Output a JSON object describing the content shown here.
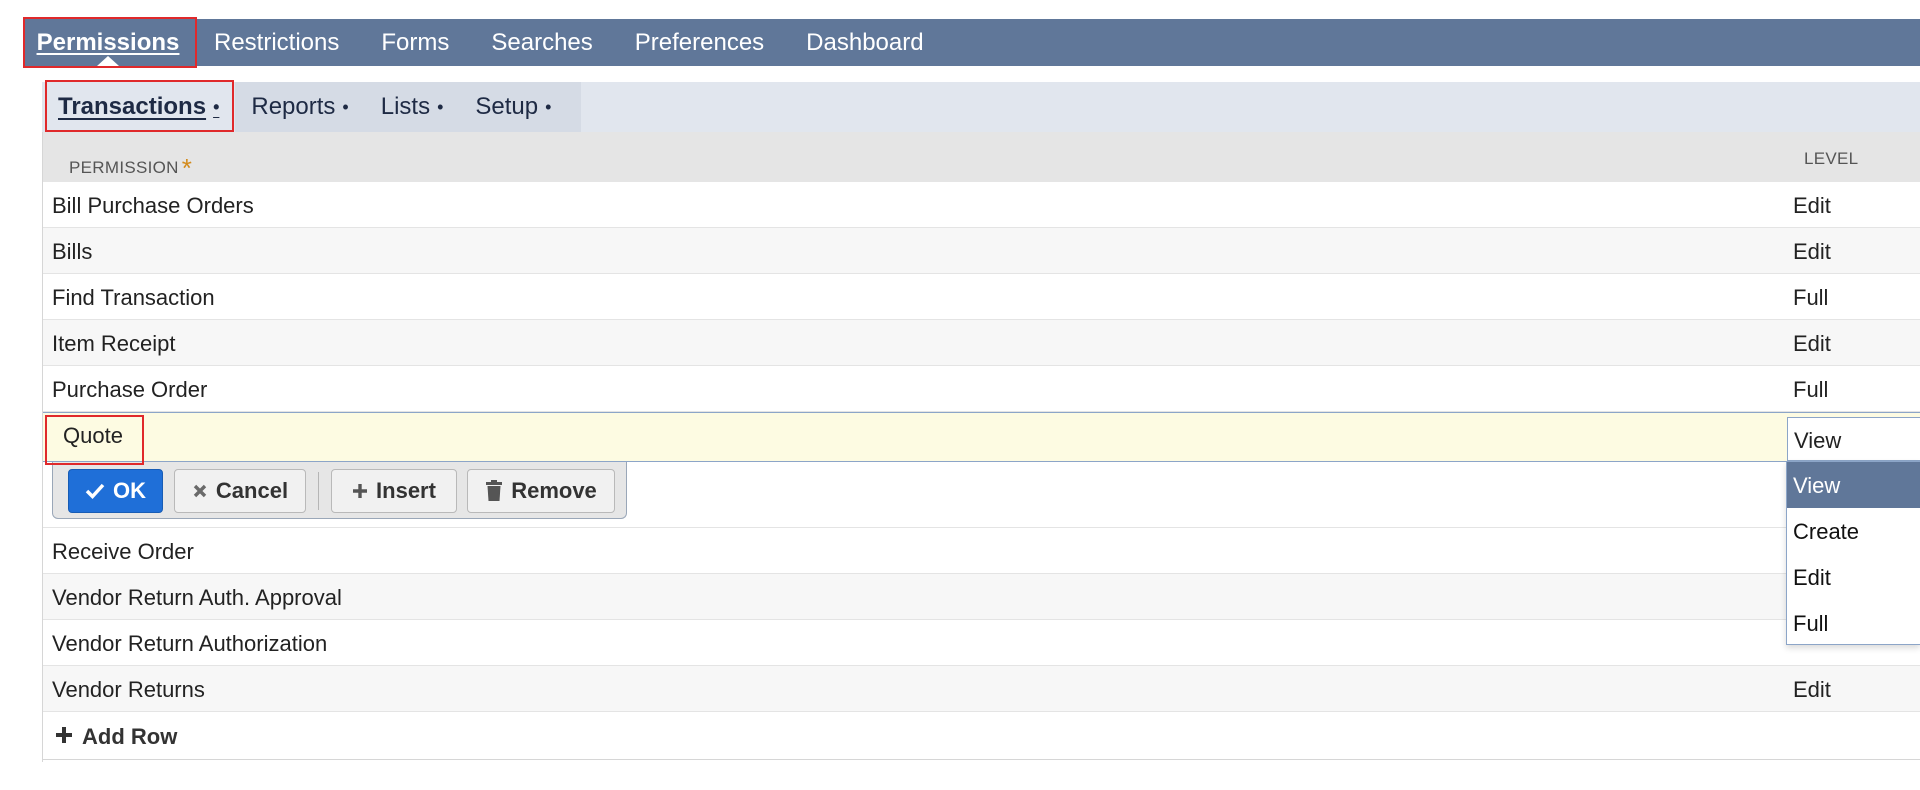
{
  "top_tabs": [
    {
      "label": "Permissions",
      "active": true
    },
    {
      "label": "Restrictions",
      "active": false
    },
    {
      "label": "Forms",
      "active": false
    },
    {
      "label": "Searches",
      "active": false
    },
    {
      "label": "Preferences",
      "active": false
    },
    {
      "label": "Dashboard",
      "active": false
    }
  ],
  "sub_tabs": [
    {
      "label": "Transactions",
      "dot": "•",
      "active": true
    },
    {
      "label": "Reports",
      "dot": "•",
      "active": false
    },
    {
      "label": "Lists",
      "dot": "•",
      "active": false
    },
    {
      "label": "Setup",
      "dot": "•",
      "active": false
    }
  ],
  "table": {
    "header_permission": "PERMISSION",
    "required_marker": "*",
    "header_level": "LEVEL",
    "rows_before": [
      {
        "permission": "Bill Purchase Orders",
        "level": "Edit"
      },
      {
        "permission": "Bills",
        "level": "Edit"
      },
      {
        "permission": "Find Transaction",
        "level": "Full"
      },
      {
        "permission": "Item Receipt",
        "level": "Edit"
      },
      {
        "permission": "Purchase Order",
        "level": "Full"
      }
    ],
    "editing_row": {
      "permission": "Quote",
      "level": "View"
    },
    "rows_after": [
      {
        "permission": "Receive Order",
        "level": ""
      },
      {
        "permission": "Vendor Return Auth. Approval",
        "level": ""
      },
      {
        "permission": "Vendor Return Authorization",
        "level": ""
      },
      {
        "permission": "Vendor Returns",
        "level": "Edit"
      }
    ],
    "add_row_label": "Add Row",
    "add_row_icon": "plus-icon"
  },
  "edit_buttons": {
    "ok": "OK",
    "cancel": "Cancel",
    "insert": "Insert",
    "remove": "Remove"
  },
  "level_dropdown": {
    "selected": "View",
    "options": [
      "View",
      "Create",
      "Edit",
      "Full"
    ]
  },
  "colors": {
    "top_bar": "#607799",
    "ok_button": "#1f6fd8",
    "editing_row": "#fdfbe2",
    "highlight": "#e0292b",
    "required": "#d38b1c"
  }
}
